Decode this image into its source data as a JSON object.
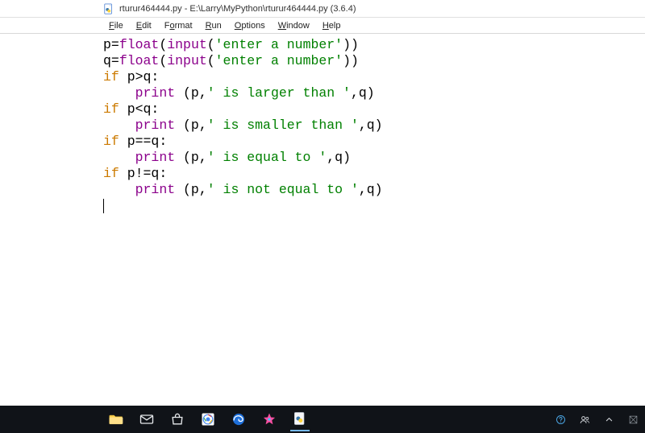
{
  "window": {
    "title": "rturur464444.py - E:\\Larry\\MyPython\\rturur464444.py (3.6.4)"
  },
  "menu": {
    "file": "File",
    "edit": "Edit",
    "format": "Format",
    "run": "Run",
    "options": "Options",
    "window": "Window",
    "help": "Help"
  },
  "code": {
    "l1": {
      "v1": "p",
      "op": "=",
      "fn": "float",
      "p1": "(",
      "fn2": "input",
      "p2": "(",
      "s": "'enter a number'",
      "p3": "))"
    },
    "l2": {
      "v1": "q",
      "op": "=",
      "fn": "float",
      "p1": "(",
      "fn2": "input",
      "p2": "(",
      "s": "'enter a number'",
      "p3": "))"
    },
    "l3": {
      "kw": "if",
      "rest": " p>q:"
    },
    "l4": {
      "indent": "    ",
      "fn": "print",
      "p1": " (p,",
      "s": "' is larger than '",
      "p2": ",q)"
    },
    "l5": {
      "kw": "if",
      "rest": " p<q:"
    },
    "l6": {
      "indent": "    ",
      "fn": "print",
      "p1": " (p,",
      "s": "' is smaller than '",
      "p2": ",q)"
    },
    "l7": {
      "kw": "if",
      "rest": " p==q:"
    },
    "l8": {
      "indent": "    ",
      "fn": "print",
      "p1": " (p,",
      "s": "' is equal to '",
      "p2": ",q)"
    },
    "l9": {
      "kw": "if",
      "rest": " p!=q:"
    },
    "l10": {
      "indent": "    ",
      "fn": "print",
      "p1": " (p,",
      "s": "' is not equal to '",
      "p2": ",q)"
    }
  },
  "icons": {
    "app": "python-file-icon",
    "explorer": "file-explorer-icon",
    "mail": "mail-icon",
    "store": "store-icon",
    "chrome": "chrome-icon",
    "edge": "edge-icon",
    "paint": "paint-icon",
    "idle": "idle-icon",
    "help": "help-circle-icon",
    "people": "people-icon",
    "chevron": "chevron-up-icon",
    "placeholder": "placeholder-icon"
  }
}
